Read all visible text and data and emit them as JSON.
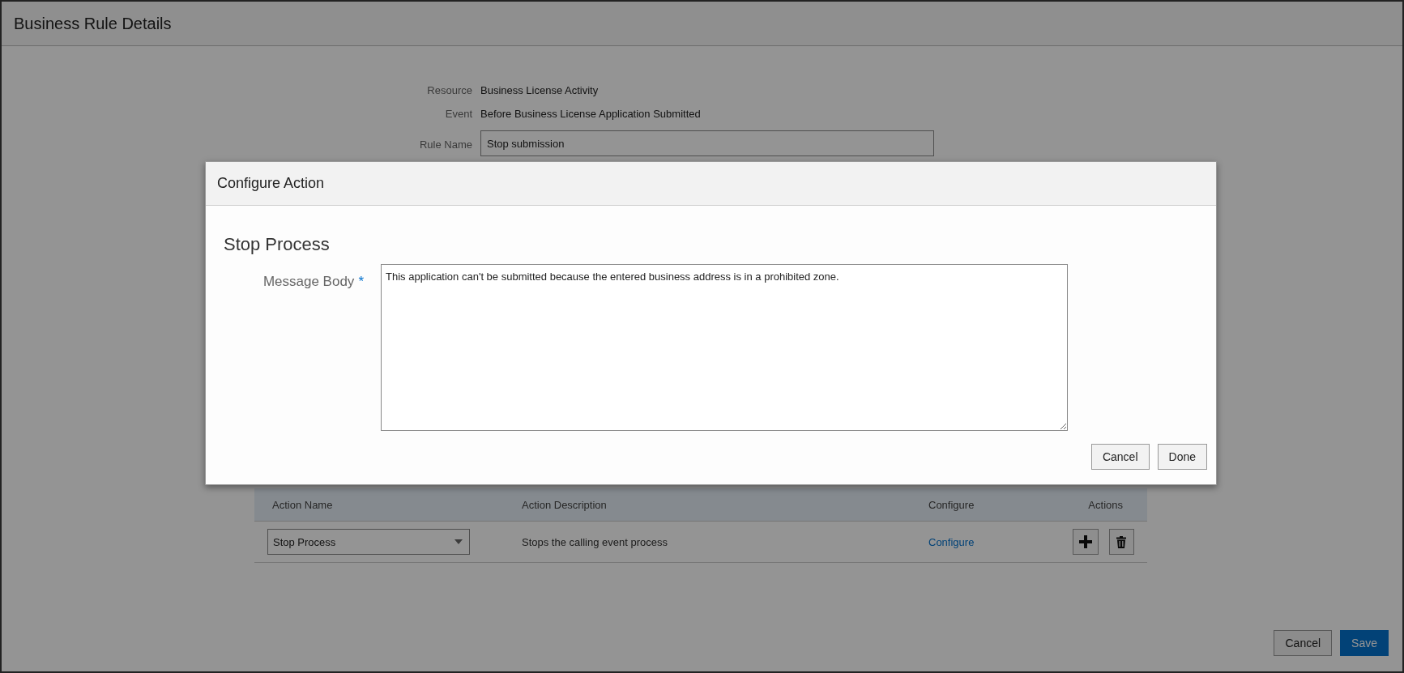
{
  "page": {
    "title": "Business Rule Details"
  },
  "form": {
    "fields": [
      {
        "label": "Resource",
        "kind": "text",
        "value": "Business License Activity"
      },
      {
        "label": "Event",
        "kind": "text",
        "value": "Before Business License Application Submitted"
      },
      {
        "label": "Rule Name",
        "kind": "input",
        "value": "Stop submission"
      }
    ]
  },
  "actions_table": {
    "columns": [
      "Action Name",
      "Action Description",
      "Configure",
      "Actions"
    ],
    "rows": [
      {
        "action_name": "Stop Process",
        "description": "Stops the calling event process",
        "configure": "Configure"
      }
    ]
  },
  "footer": {
    "buttons": [
      {
        "label": "Cancel",
        "kind": "secondary"
      },
      {
        "label": "Save",
        "kind": "primary"
      }
    ]
  },
  "dialog": {
    "title": "Configure Action",
    "heading": "Stop Process",
    "field": {
      "label": "Message Body",
      "required_mark": "*",
      "value": "This application can't be submitted because the entered business address is in a prohibited zone."
    },
    "buttons": [
      {
        "label": "Cancel"
      },
      {
        "label": "Done"
      }
    ]
  }
}
